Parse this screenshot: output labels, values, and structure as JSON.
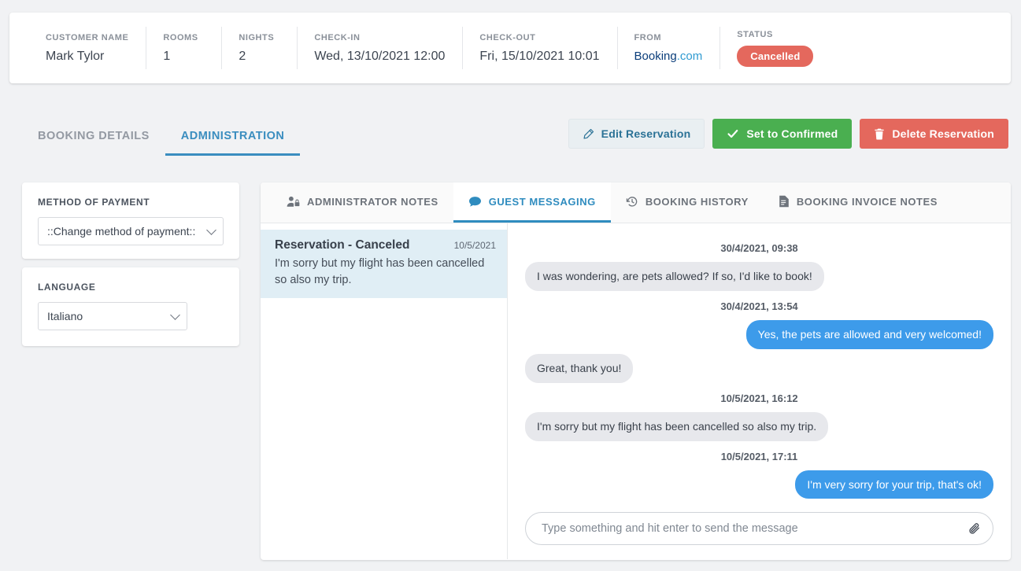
{
  "summary": {
    "fields": [
      {
        "label": "CUSTOMER NAME",
        "value": "Mark Tylor"
      },
      {
        "label": "ROOMS",
        "value": "1"
      },
      {
        "label": "NIGHTS",
        "value": "2"
      },
      {
        "label": "CHECK-IN",
        "value": "Wed, 13/10/2021 12:00"
      },
      {
        "label": "CHECK-OUT",
        "value": "Fri, 15/10/2021 10:01"
      }
    ],
    "from": {
      "label": "FROM",
      "brand": "Booking",
      "suffix": ".com"
    },
    "status": {
      "label": "STATUS",
      "value": "Cancelled",
      "color": "#e4685d"
    }
  },
  "top_tabs": [
    {
      "label": "BOOKING DETAILS",
      "active": false
    },
    {
      "label": "ADMINISTRATION",
      "active": true
    }
  ],
  "actions": {
    "edit": {
      "label": "Edit Reservation",
      "icon": "pencil-icon"
    },
    "confirm": {
      "label": "Set to Confirmed",
      "icon": "check-icon",
      "color": "#4aaf50"
    },
    "delete": {
      "label": "Delete Reservation",
      "icon": "trash-icon",
      "color": "#e4685d"
    }
  },
  "sidebar": {
    "payment": {
      "label": "METHOD OF PAYMENT",
      "value": "::Change method of payment::"
    },
    "language": {
      "label": "LANGUAGE",
      "value": "Italiano"
    }
  },
  "inner_tabs": [
    {
      "label": "ADMINISTRATOR NOTES",
      "icon": "user-lock-icon",
      "active": false
    },
    {
      "label": "GUEST MESSAGING",
      "icon": "chat-bubble-icon",
      "active": true
    },
    {
      "label": "BOOKING HISTORY",
      "icon": "history-clock-icon",
      "active": false
    },
    {
      "label": "BOOKING INVOICE NOTES",
      "icon": "invoice-document-icon",
      "active": false
    }
  ],
  "conversation_list": [
    {
      "title": "Reservation - Canceled",
      "date": "10/5/2021",
      "snippet": "I'm sorry but my flight has been cancelled so also my trip.",
      "selected": true
    }
  ],
  "chat": {
    "entries": [
      {
        "kind": "timestamp",
        "text": "30/4/2021, 09:38"
      },
      {
        "kind": "message",
        "side": "in",
        "text": "I was wondering, are pets allowed? If so, I'd like to book!"
      },
      {
        "kind": "timestamp",
        "text": "30/4/2021, 13:54"
      },
      {
        "kind": "message",
        "side": "out",
        "text": "Yes, the pets are allowed and very welcomed!"
      },
      {
        "kind": "message",
        "side": "in",
        "text": "Great, thank you!"
      },
      {
        "kind": "timestamp",
        "text": "10/5/2021, 16:12"
      },
      {
        "kind": "message",
        "side": "in",
        "text": "I'm sorry but my flight has been cancelled so also my trip."
      },
      {
        "kind": "timestamp",
        "text": "10/5/2021, 17:11"
      },
      {
        "kind": "message",
        "side": "out",
        "text": "I'm very sorry for your trip, that's ok!"
      }
    ],
    "composer": {
      "value": "",
      "placeholder": "Type something and hit enter to send the message",
      "attach_icon": "paperclip-icon"
    }
  }
}
